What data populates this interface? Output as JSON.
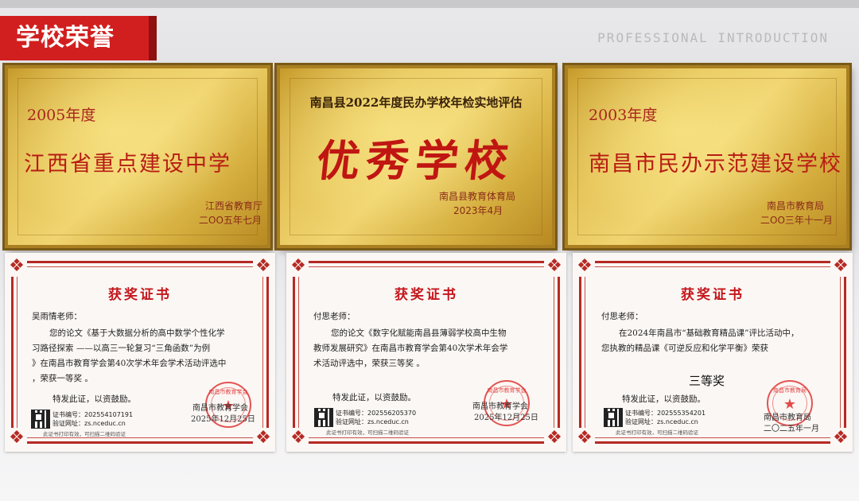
{
  "header": {
    "title": "学校荣誉",
    "subtitle": "PROFESSIONAL INTRODUCTION"
  },
  "plaques": [
    {
      "year": "2005年度",
      "title": "江西省重点建设中学",
      "issuer": "江西省教育厅",
      "date": "二OO五年七月"
    },
    {
      "top": "南昌县2022年度民办学校年检实地评估",
      "big": "优秀学校",
      "issuer": "南昌县教育体育局",
      "date": "2023年4月"
    },
    {
      "year": "2003年度",
      "title": "南昌市民办示范建设学校",
      "issuer": "南昌市教育局",
      "date": "二OO三年十一月"
    }
  ],
  "certificates": [
    {
      "title": "获奖证书",
      "recipient": "吴雨情老师：",
      "body_lines": [
        "您的论文《基于大数据分析的高中数学个性化学",
        "习路径探索 ——以高三一轮复习“三角函数”为例",
        "》在南昌市教育学会第40次学术年会学术活动评选中",
        "，荣获一等奖 。"
      ],
      "encourage": "特发此证，以资鼓励。",
      "org": "南昌市教育学会",
      "date": "2025年12月25日",
      "code": "证书编号：202554107191",
      "site": "验证网址：zs.nceduc.cn",
      "note": "此证书打印有效，可扫描二维码验证"
    },
    {
      "title": "获奖证书",
      "recipient": "付思老师：",
      "body_lines": [
        "您的论文《数字化赋能南昌县薄弱学校高中生物",
        "教师发展研究》在南昌市教育学会第40次学术年会学",
        "术活动评选中，荣获三等奖 。"
      ],
      "encourage": "特发此证，以资鼓励。",
      "org": "南昌市教育学会",
      "date": "2025年12月25日",
      "code": "证书编号：202556205370",
      "site": "验证网址：zs.nceduc.cn",
      "note": "此证书打印有效，可扫描二维码验证"
    },
    {
      "title": "获奖证书",
      "recipient": "付思老师：",
      "body_lines": [
        "在2024年南昌市“基础教育精品课”评比活动中，",
        "您执教的精品课《可逆反应和化学平衡》荣获"
      ],
      "prize": "三等奖",
      "encourage": "特发此证，以资鼓励。",
      "org": "南昌市教育局",
      "date": "二〇二五年一月",
      "code": "证书编号：202555354201",
      "site": "验证网址：zs.nceduc.cn",
      "note": "此证书打印有效，可扫描二维码验证"
    }
  ]
}
